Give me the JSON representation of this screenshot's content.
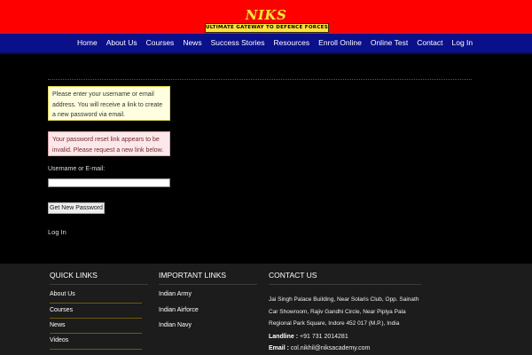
{
  "header": {
    "logo_name": "NIKS ACADEMY",
    "logo_tagline": "ULTIMATE GATEWAY TO DEFENCE FORCES",
    "colors": {
      "top_bar": "#ff0000",
      "nav_bar": "#0a0f8a",
      "logo": "#ffe23a"
    }
  },
  "nav": {
    "items": [
      "Home",
      "About Us",
      "Courses",
      "News",
      "Success Stories",
      "Resources",
      "Enroll Online",
      "Online Test",
      "Contact",
      "Log In"
    ]
  },
  "form": {
    "info_message": "Please enter your username or email address. You will receive a link to create a new password via email.",
    "error_message": "Your password reset link appears to be invalid. Please request a new link below.",
    "username_label": "Username or E-mail:",
    "username_value": "",
    "submit_label": "Get New Password",
    "login_link": "Log In"
  },
  "footer": {
    "quick_links": {
      "title": "QUICK LINKS",
      "items": [
        "About Us",
        "Courses",
        "News",
        "Videos"
      ]
    },
    "important_links": {
      "title": "IMPORTANT LINKS",
      "items": [
        "Indian Army",
        "Indian Airforce",
        "Indian Navy"
      ]
    },
    "contact": {
      "title": "CONTACT US",
      "address": "Jai Singh Palace Building, Near Solaris Club, Opp. Sainath Car Showroom, Rajiv Gandhi Circle, Near Piplya Pala Regional Park Square, Indore 452 017 (M.P.), India",
      "landline_label": "Landline :",
      "landline_value": "+91 731 2014281",
      "email_label": "Email :",
      "email_value": "col.nikhil@niksacademy.com"
    }
  }
}
